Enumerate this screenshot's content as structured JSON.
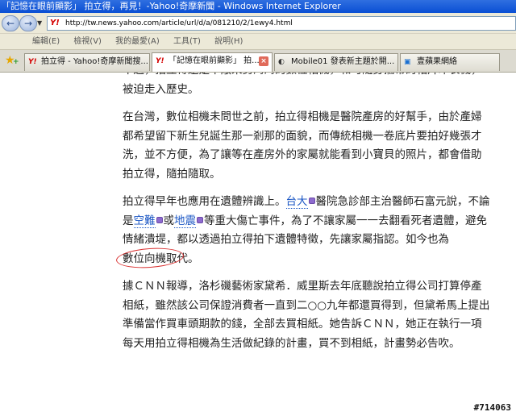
{
  "window": {
    "title": "「記憶在眼前顯影」 拍立得，再見！-Yahoo!奇摩新聞 - Windows Internet Explorer"
  },
  "navigation": {
    "back_glyph": "←",
    "forward_glyph": "→",
    "dropdown_glyph": "▼",
    "address_icon": "Y!",
    "url": "http://tw.news.yahoo.com/article/url/d/a/081210/2/1ewy4.html"
  },
  "menu": {
    "items": [
      "編輯(E)",
      "檢視(V)",
      "我的最愛(A)",
      "工具(T)",
      "說明(H)"
    ]
  },
  "tabs": [
    {
      "icon": "Y!",
      "label": "拍立得 - Yahoo!奇摩新聞搜...",
      "active": false
    },
    {
      "icon": "Y!",
      "label": "「記憶在眼前顯影」 拍...",
      "active": true,
      "close": "×"
    },
    {
      "icon": "◐",
      "label": "Mobile01 發表新主題於開...",
      "active": false
    },
    {
      "icon": "▣",
      "label": "壹蘋果網絡",
      "active": false
    }
  ],
  "favorites": {
    "star_glyph": "★",
    "add_glyph": "+"
  },
  "article": {
    "p0": "不過，拍立得還是不敵來勢洶洶的數位相機，和可隨身攜帶的相片印表機，被迫走入歷史。",
    "p1": "在台灣，數位相機未問世之前，拍立得相機是醫院產房的好幫手，由於產婦都希望留下新生兒誕生那一剎那的面貌，而傳統相機一卷底片要拍好幾張才洗，並不方便，為了讓等在產房外的家屬就能看到小寶貝的照片，都會借助拍立得，隨拍隨取。",
    "p2_a": "拍立得早年也應用在遺體辨識上。",
    "p2_kw1": "台大",
    "p2_b": "醫院急診部主治醫師石富元說，不論是",
    "p2_kw2": "空難",
    "p2_c": "或",
    "p2_kw3": "地震",
    "p2_d": "等重大傷亡事件，為了不讓家屬一一去翻看死者遺體，避免情緒潰堤，都以透過拍立得拍下遺體特徵，先讓家屬指認。如今也為",
    "p2_circled": "數位向機",
    "p2_e": "取代。",
    "p3": "據ＣＮＮ報導，洛杉磯藝術家黛希．威里斯去年底聽說拍立得公司打算停產相紙，雖然該公司保證消費者一直到二○○九年都還買得到，但黛希馬上提出準備當作買車頭期款的錢，全部去買相紙。她告訴ＣＮＮ，她正在執行一項每天用拍立得相機為生活做紀錄的計畫，買不到相紙，計畫勢必告吹。"
  },
  "watermark": "#714063",
  "colors": {
    "titlebar": "#0a4fd4",
    "keyword_link": "#1a56c4",
    "annotation_circle": "#d93030"
  }
}
